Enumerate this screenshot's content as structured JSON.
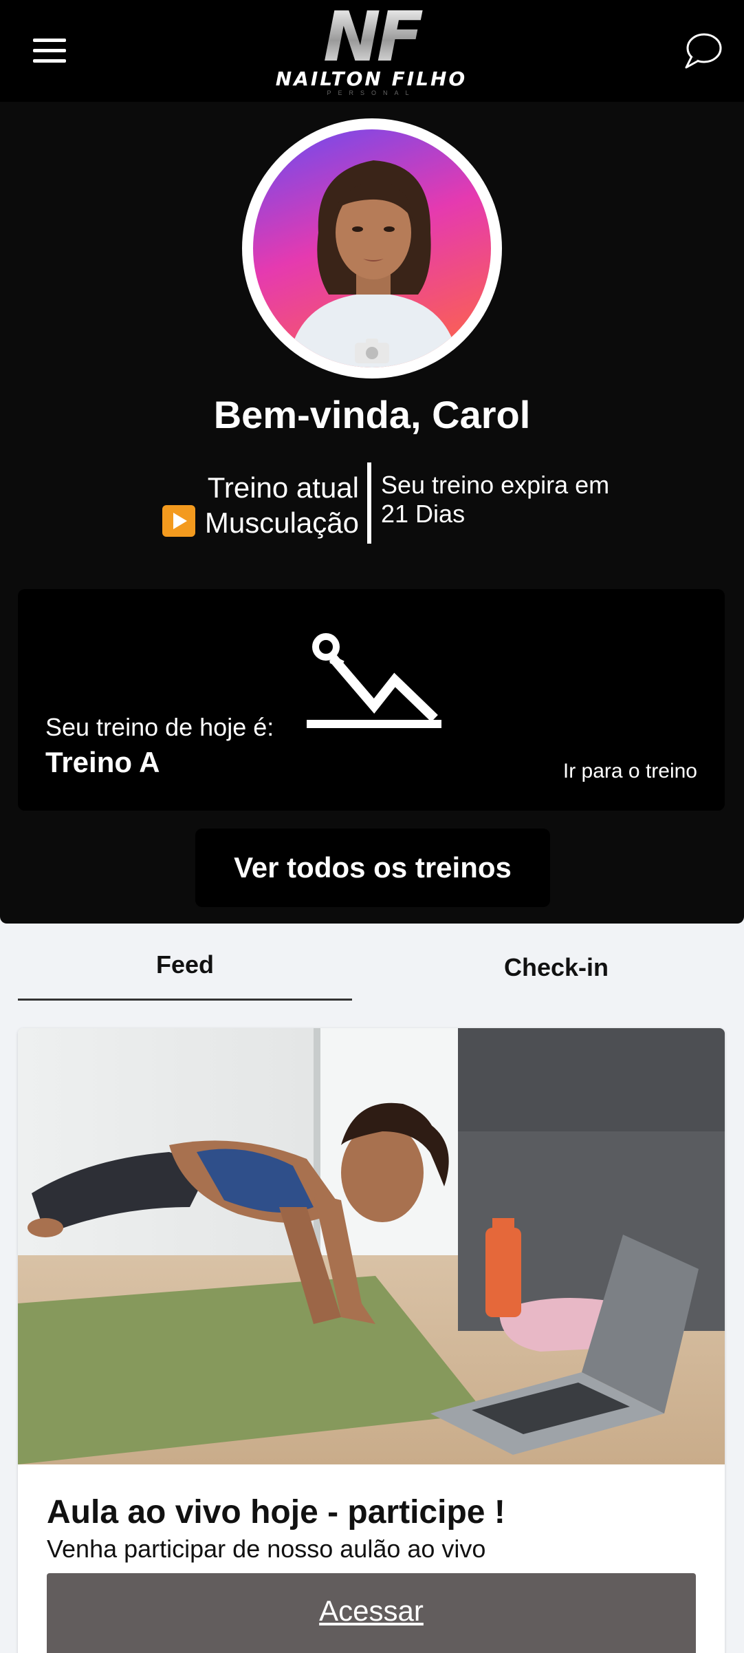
{
  "header": {
    "logo_monogram": "NF",
    "logo_name": "NAILTON FILHO",
    "logo_sub": "PERSONAL",
    "menu_icon": "hamburger-menu-icon",
    "chat_icon": "chat-bubble-icon"
  },
  "profile": {
    "welcome": "Bem-vinda, Carol",
    "current_label": "Treino atual",
    "current_value": "Musculação",
    "expire_label": "Seu treino expira em",
    "expire_value": "21 Dias"
  },
  "today": {
    "label": "Seu treino de hoje é:",
    "name": "Treino A",
    "link": "Ir para o treino",
    "icon": "exercise-situp-icon"
  },
  "all_workouts_button": "Ver todos os treinos",
  "tabs": [
    {
      "label": "Feed",
      "active": true
    },
    {
      "label": "Check-in",
      "active": false
    }
  ],
  "feed": [
    {
      "title": "Aula ao vivo hoje - participe !",
      "description": "Venha participar de nosso aulão ao vivo",
      "button": "Acessar"
    }
  ],
  "colors": {
    "header_bg": "#000000",
    "hero_bg": "#0b0b0b",
    "page_bg": "#f1f3f6",
    "button_gray": "#625d5d",
    "play_orange": "#f39a1e"
  }
}
